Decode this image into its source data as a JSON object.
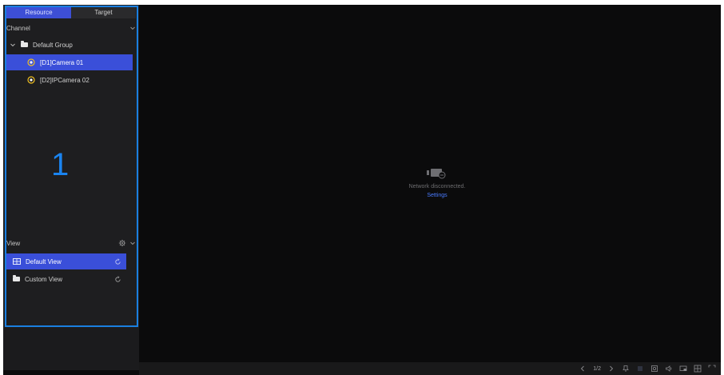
{
  "tabs": {
    "resource": "Resource",
    "target": "Target"
  },
  "channel_section": {
    "label": "Channel"
  },
  "group": {
    "label": "Default Group"
  },
  "channels": [
    {
      "label": "[D1]Camera 01",
      "selected": true
    },
    {
      "label": "[D2]IPCamera 02",
      "selected": false
    }
  ],
  "annotation": {
    "number": "1"
  },
  "view_section": {
    "label": "View"
  },
  "views": [
    {
      "label": "Default View",
      "selected": true
    },
    {
      "label": "Custom View",
      "selected": false
    }
  ],
  "video": {
    "status_text": "Network disconnected.",
    "settings_link": "Settings"
  },
  "toolbar": {
    "page_indicator": "1/2"
  },
  "colors": {
    "accent": "#3a4fd9",
    "annotation_blue": "#1a7fe0",
    "link": "#4a7bff"
  }
}
